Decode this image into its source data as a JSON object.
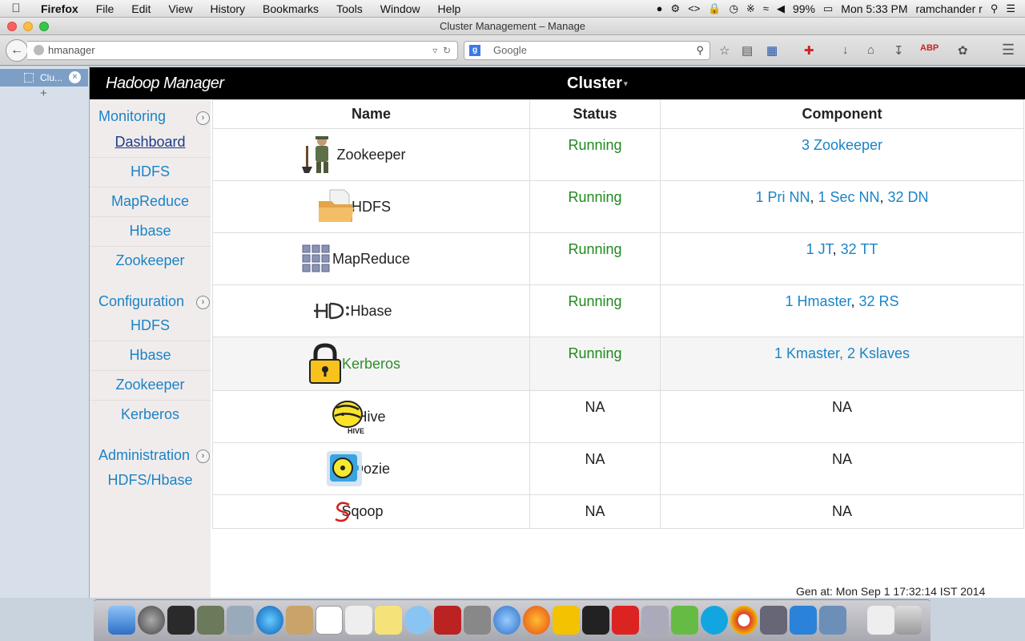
{
  "menubar": {
    "app": "Firefox",
    "items": [
      "File",
      "Edit",
      "View",
      "History",
      "Bookmarks",
      "Tools",
      "Window",
      "Help"
    ],
    "battery": "99%",
    "clock": "Mon 5:33 PM",
    "user": "ramchander r"
  },
  "window": {
    "title": "Cluster Management – Manage"
  },
  "toolbar": {
    "url": "hmanager",
    "search_placeholder": "Google"
  },
  "tabs": [
    {
      "label": "Clu..."
    }
  ],
  "app": {
    "brand": "Hadoop Manager",
    "cluster_menu": "Cluster"
  },
  "nav": {
    "monitoring": {
      "title": "Monitoring",
      "items": [
        "Dashboard",
        "HDFS",
        "MapReduce",
        "Hbase",
        "Zookeeper"
      ]
    },
    "configuration": {
      "title": "Configuration",
      "items": [
        "HDFS",
        "Hbase",
        "Zookeeper",
        "Kerberos"
      ]
    },
    "administration": {
      "title": "Administration",
      "items": [
        "HDFS/Hbase"
      ]
    }
  },
  "table": {
    "headers": [
      "Name",
      "Status",
      "Component"
    ],
    "rows": [
      {
        "name": "Zookeeper",
        "status": "Running",
        "component": [
          "3 Zookeeper"
        ]
      },
      {
        "name": "HDFS",
        "status": "Running",
        "component": [
          "1 Pri NN",
          "1 Sec NN",
          "32 DN"
        ]
      },
      {
        "name": "MapReduce",
        "status": "Running",
        "component": [
          "1 JT",
          "32 TT"
        ]
      },
      {
        "name": "Hbase",
        "status": "Running",
        "component": [
          "1 Hmaster",
          "32 RS"
        ]
      },
      {
        "name": "Kerberos",
        "status": "Running",
        "component": [
          "1 Kmaster, 2 Kslaves"
        ]
      },
      {
        "name": "Hive",
        "status": "NA",
        "component": [
          "NA"
        ]
      },
      {
        "name": "Oozie",
        "status": "NA",
        "component": [
          "NA"
        ]
      },
      {
        "name": "Sqoop",
        "status": "NA",
        "component": [
          "NA"
        ]
      }
    ]
  },
  "footer": {
    "generated": "Gen at: Mon Sep 1 17:32:14 IST 2014"
  },
  "colors": {
    "link": "#1a84c7",
    "running": "#1f8a1f",
    "header_bg": "#000000",
    "nav_bg": "#f1ecec"
  }
}
